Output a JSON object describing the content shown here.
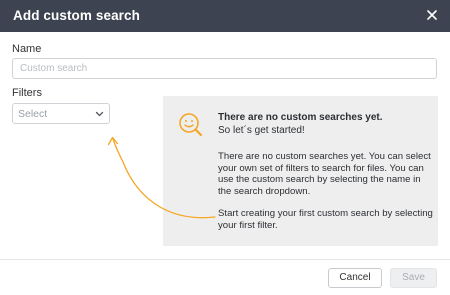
{
  "dialog": {
    "title": "Add custom search",
    "close_icon": "close-icon"
  },
  "form": {
    "name_label": "Name",
    "name_placeholder": "Custom search",
    "name_value": "",
    "filters_label": "Filters",
    "filters_select_value": "Select",
    "filters_select_icon": "chevron-down-icon"
  },
  "empty_state": {
    "icon": "smiley-magnifier-icon",
    "heading": "There are no custom searches yet.",
    "subheading": "So let´s get started!",
    "paragraph1": "There are no custom searches yet. You can select your own set of filters to search for files. You can use the custom search by selecting the name in the search dropdown.",
    "paragraph2": "Start creating your first custom search by selecting your first filter.",
    "pointer_arrow": "curved-arrow-icon"
  },
  "footer": {
    "cancel_label": "Cancel",
    "save_label": "Save"
  },
  "colors": {
    "header_bg": "#3d4350",
    "accent": "#f5a623",
    "panel_bg": "#eeeeef"
  }
}
